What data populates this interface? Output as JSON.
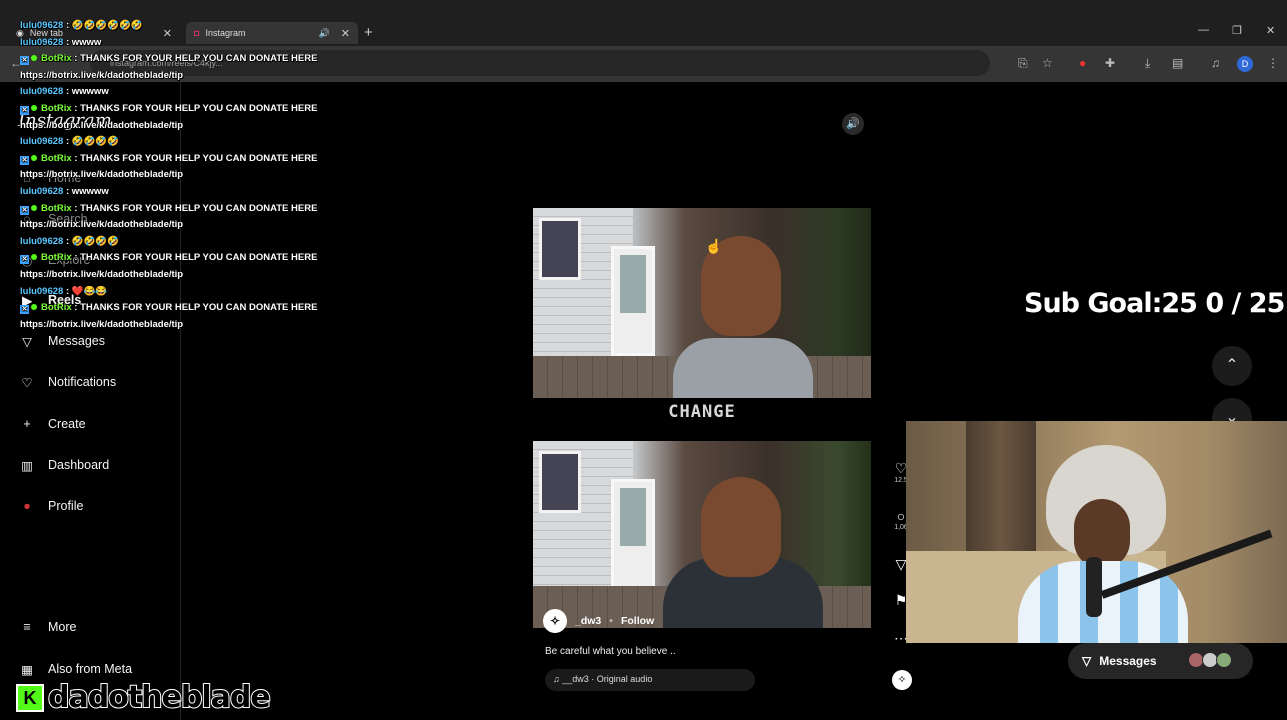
{
  "browser": {
    "tabs": [
      {
        "title": "New tab"
      },
      {
        "title": "Instagram"
      }
    ],
    "url": "instagram.com/reels/C4kjy..."
  },
  "chat": {
    "messages": [
      {
        "user": "lulu09628",
        "text": "🤣🤣🤣🤣🤣🤣",
        "type": "user"
      },
      {
        "user": "lulu09628",
        "text": "wwww",
        "type": "user"
      },
      {
        "user": "BotRix",
        "text": "THANKS FOR YOUR HELP YOU CAN DONATE HERE",
        "link": "https://botrix.live/k/dadotheblade/tip",
        "type": "bot"
      },
      {
        "user": "lulu09628",
        "text": "wwwww",
        "type": "user"
      },
      {
        "user": "BotRix",
        "text": "THANKS FOR YOUR HELP YOU CAN DONATE HERE",
        "link": "https://botrix.live/k/dadotheblade/tip",
        "type": "bot"
      },
      {
        "user": "lulu09628",
        "text": "🤣🤣🤣🤣",
        "type": "user"
      },
      {
        "user": "BotRix",
        "text": "THANKS FOR YOUR HELP YOU CAN DONATE HERE",
        "link": "https://botrix.live/k/dadotheblade/tip",
        "type": "bot"
      },
      {
        "user": "lulu09628",
        "text": "wwwww",
        "type": "user"
      },
      {
        "user": "BotRix",
        "text": "THANKS FOR YOUR HELP YOU CAN DONATE HERE",
        "link": "https://botrix.live/k/dadotheblade/tip",
        "type": "bot"
      },
      {
        "user": "lulu09628",
        "text": "🤣🤣🤣🤣",
        "type": "user"
      },
      {
        "user": "BotRix",
        "text": "THANKS FOR YOUR HELP YOU CAN DONATE HERE",
        "link": "https://botrix.live/k/dadotheblade/tip",
        "type": "bot"
      },
      {
        "user": "lulu09628",
        "text": "❤️😂😂",
        "type": "user"
      },
      {
        "user": "BotRix",
        "text": "THANKS FOR YOUR HELP YOU CAN DONATE HERE",
        "link": "https://botrix.live/k/dadotheblade/tip",
        "type": "bot"
      }
    ]
  },
  "sidebar": {
    "logo": "Instagram",
    "items": [
      {
        "label": "Home",
        "icon": "home-icon"
      },
      {
        "label": "Search",
        "icon": "search-icon"
      },
      {
        "label": "Explore",
        "icon": "compass-icon"
      },
      {
        "label": "Reels",
        "icon": "reels-icon"
      },
      {
        "label": "Messages",
        "icon": "messenger-icon"
      },
      {
        "label": "Notifications",
        "icon": "heart-icon"
      },
      {
        "label": "Create",
        "icon": "plus-icon"
      },
      {
        "label": "Dashboard",
        "icon": "dashboard-icon"
      },
      {
        "label": "Profile",
        "icon": "profile-avatar"
      },
      {
        "label": "More",
        "icon": "menu-icon"
      },
      {
        "label": "Also from Meta",
        "icon": "meta-icon"
      }
    ]
  },
  "reel": {
    "overlay_text": "CHANGE",
    "author": "_dw3",
    "follow_label": "Follow",
    "caption": "Be careful what you believe ..",
    "audio": "__dw3 · Original audio",
    "likes": "12.5",
    "comments": "1,06"
  },
  "stream": {
    "sub_goal": "Sub Goal:25  0 / 25",
    "streamer_name": "dadotheblade",
    "messages_label": "Messages"
  }
}
